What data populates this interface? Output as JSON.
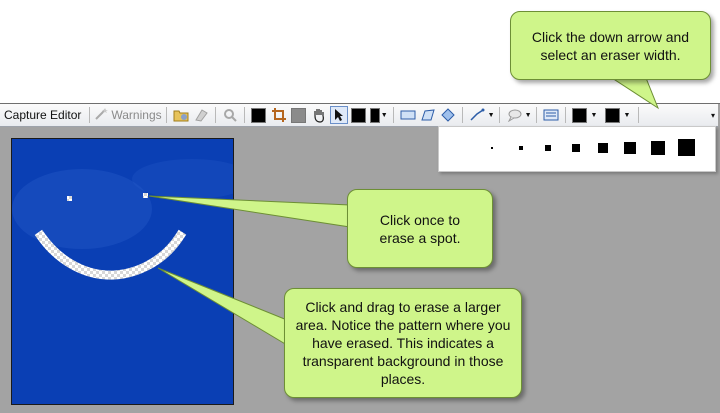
{
  "toolbar": {
    "title": "Capture Editor",
    "warnings_label": "Warnings"
  },
  "icons": {
    "warnings": "wand-icon",
    "folder": "folder-icon",
    "erase_shapes": "erase-shapes-icon",
    "zoom": "magnifier-icon",
    "fill": "fill-color-icon",
    "crop": "crop-icon",
    "hand": "hand-icon",
    "pointer": "pointer-icon",
    "rectangle": "rectangle-icon",
    "polygon": "polygon-icon",
    "ellipse": "ellipse-icon",
    "line": "line-icon",
    "callout": "callout-icon",
    "text_box": "text-box-icon",
    "eraser": "eraser-icon",
    "more": "more-chevron-icon"
  },
  "eraser_widths_count": 8,
  "callouts": {
    "eraser_arrow": "Click the down arrow and select an eraser width.",
    "spot": "Click once to erase a spot.",
    "drag": "Click and drag to erase a larger area. Notice the pattern where you have erased. This indicates a transparent background in those places."
  },
  "colors": {
    "callout_fill": "#cff58a",
    "canvas_blue": "#0a3fb4",
    "workspace_gray": "#a3a3a3"
  }
}
